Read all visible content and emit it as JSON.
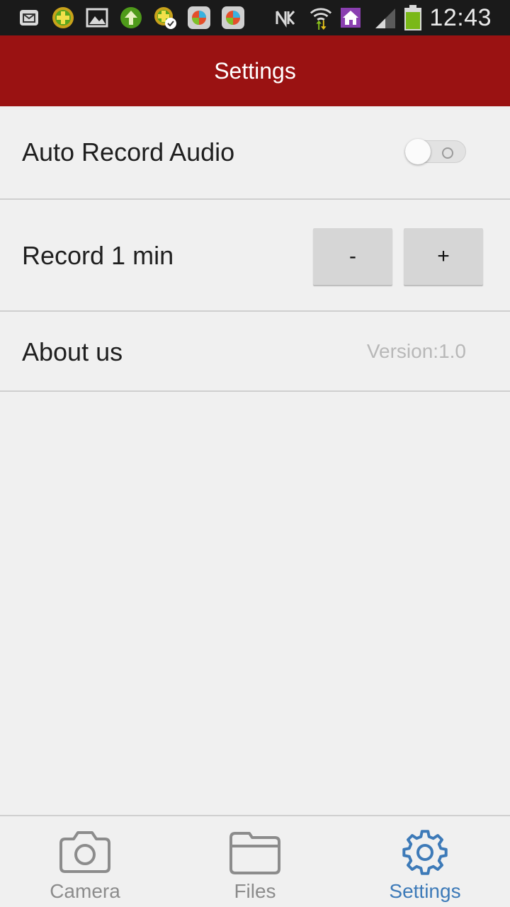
{
  "status_bar": {
    "time": "12:43",
    "icons": [
      "mail-icon",
      "plus-circle-icon",
      "image-icon",
      "upload-arrow-icon",
      "plus-check-icon",
      "app-icon",
      "app-icon",
      "nfc-icon",
      "wifi-icon",
      "home-icon",
      "signal-icon",
      "battery-icon"
    ]
  },
  "app_bar": {
    "title": "Settings"
  },
  "settings": {
    "auto_record": {
      "label": "Auto Record Audio",
      "enabled": false
    },
    "record_duration": {
      "label": "Record 1 min",
      "decrement": "-",
      "increment": "+"
    },
    "about": {
      "label": "About us",
      "version": "Version:1.0"
    }
  },
  "tabs": [
    {
      "label": "Camera",
      "icon": "camera-icon",
      "active": false
    },
    {
      "label": "Files",
      "icon": "folder-icon",
      "active": false
    },
    {
      "label": "Settings",
      "icon": "gear-icon",
      "active": true
    }
  ],
  "colors": {
    "app_bar": "#9a1212",
    "active_tab": "#3d7ab8",
    "inactive_tab": "#8c8c8c"
  }
}
